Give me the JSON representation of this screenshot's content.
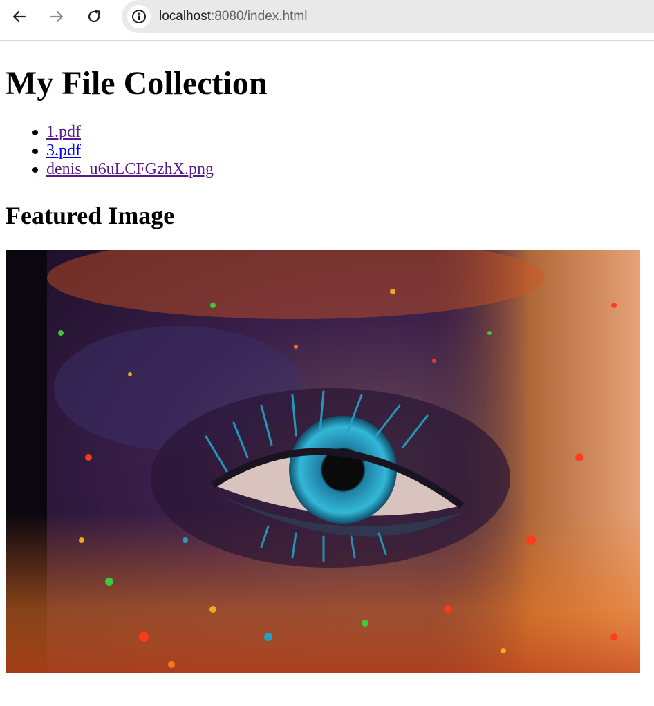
{
  "browser": {
    "url_host": "localhost",
    "url_rest": ":8080/index.html"
  },
  "page": {
    "title": "My File Collection",
    "files": [
      {
        "label": "1.pdf",
        "visited": true
      },
      {
        "label": "3.pdf",
        "visited": false
      },
      {
        "label": "denis_u6uLCFGzhX.png",
        "visited": true
      }
    ],
    "featured_heading": "Featured Image",
    "featured_image": {
      "description_colors": [
        "#2a1740",
        "#e8741f",
        "#1aa6c9",
        "#ff3a1a",
        "#3ad13a"
      ]
    }
  },
  "colors": {
    "link_visited": "#551a8b",
    "link_unvisited": "#0000ee",
    "address_bar_bg": "#e9e9e9"
  }
}
